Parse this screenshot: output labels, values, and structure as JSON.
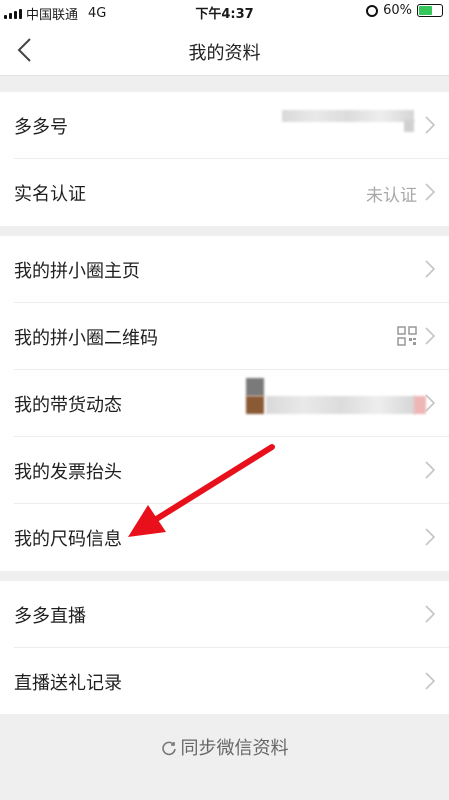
{
  "status_bar": {
    "carrier": "中国联通",
    "network": "4G",
    "time": "下午4:37",
    "battery": "60%",
    "battery_level": 0.6
  },
  "nav": {
    "title": "我的资料"
  },
  "section1": {
    "items": [
      {
        "label": "多多号"
      },
      {
        "label": "实名认证",
        "value": "未认证"
      }
    ]
  },
  "section2": {
    "items": [
      {
        "label": "我的拼小圈主页"
      },
      {
        "label": "我的拼小圈二维码",
        "icon": "qr-code-icon"
      },
      {
        "label": "我的带货动态"
      },
      {
        "label": "我的发票抬头"
      },
      {
        "label": "我的尺码信息"
      }
    ]
  },
  "section3": {
    "items": [
      {
        "label": "多多直播"
      },
      {
        "label": "直播送礼记录"
      }
    ]
  },
  "footer": {
    "sync_label": "同步微信资料"
  },
  "annotation": {
    "arrow_color": "#e8111b",
    "points_to": "我的尺码信息"
  }
}
